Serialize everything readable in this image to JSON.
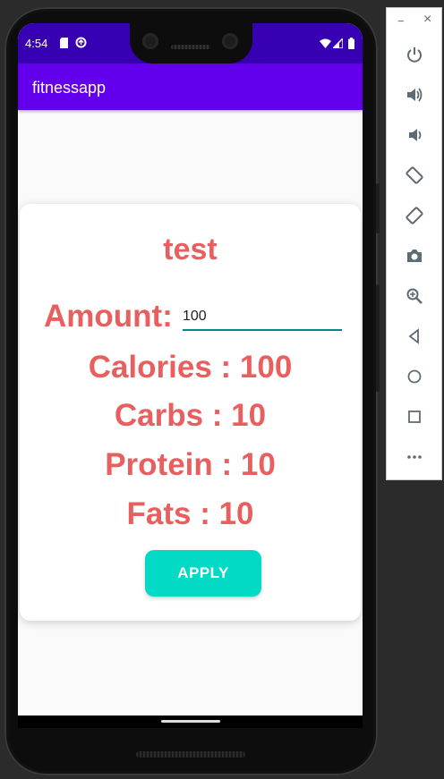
{
  "status_bar": {
    "time": "4:54",
    "icons": [
      "sd-card-icon",
      "data-saver-icon",
      "wifi-icon",
      "signal-icon",
      "battery-icon"
    ]
  },
  "app_bar": {
    "title": "fitnessapp"
  },
  "card": {
    "title": "test",
    "amount_label": "Amount:",
    "amount_value": "100",
    "calories": "Calories : 100",
    "carbs": "Carbs : 10",
    "protein": "Protein : 10",
    "fats": "Fats : 10",
    "apply_label": "APPLY"
  },
  "emulator_toolbar": {
    "minimize_label": "−",
    "close_label": "×",
    "buttons": [
      "power-icon",
      "volume-up-icon",
      "volume-down-icon",
      "rotate-left-icon",
      "rotate-right-icon",
      "camera-icon",
      "zoom-icon",
      "back-icon",
      "home-icon",
      "overview-icon",
      "more-icon"
    ]
  },
  "colors": {
    "status_bar": "#3700b3",
    "app_bar": "#6200ee",
    "accent_text": "#e95f5f",
    "button": "#03dac5",
    "input_underline": "#018786"
  }
}
